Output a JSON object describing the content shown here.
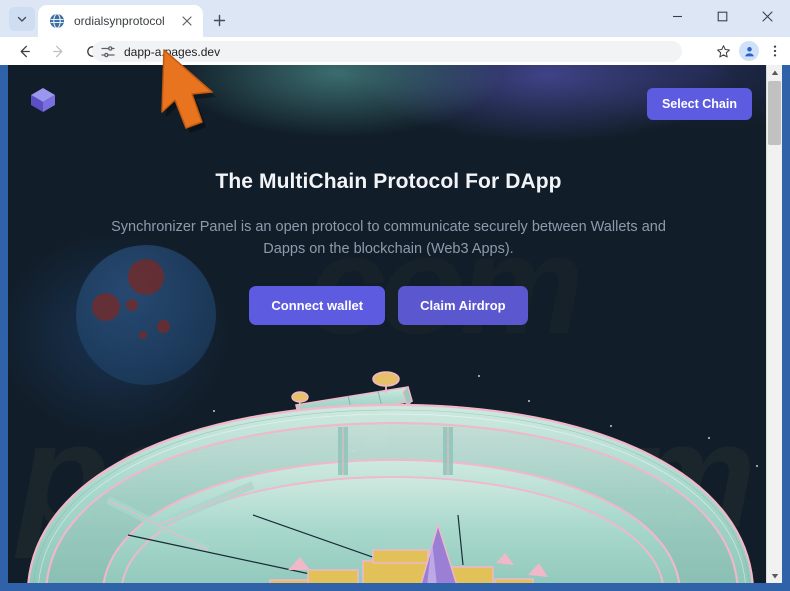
{
  "browser": {
    "tab": {
      "title": "ordialsynprotocol",
      "favicon_icon": "globe-icon",
      "close_icon": "close-icon"
    },
    "tab_search_icon": "chevron-down-icon",
    "new_tab_icon": "plus-icon",
    "window_controls": {
      "minimize_icon": "minimize-icon",
      "maximize_icon": "maximize-icon",
      "close_icon": "close-icon"
    },
    "toolbar": {
      "back_icon": "arrow-left-icon",
      "forward_icon": "arrow-right-icon",
      "reload_icon": "reload-icon",
      "site_settings_icon": "sliders-icon",
      "url": "dapp-a.pages.dev",
      "bookmark_icon": "star-icon",
      "profile_icon": "person-icon",
      "menu_icon": "three-dots-icon"
    },
    "scrollbar": {
      "up_icon": "triangle-up-icon",
      "down_icon": "triangle-down-icon"
    }
  },
  "page": {
    "header": {
      "logo_icon": "cube-logo-icon",
      "select_chain_label": "Select Chain"
    },
    "hero": {
      "title": "The MultiChain Protocol For DApp",
      "subtitle": "Synchronizer Panel is an open protocol to communicate securely between Wallets and Dapps on the blockchain (Web3 Apps).",
      "connect_wallet_label": "Connect wallet",
      "claim_airdrop_label": "Claim Airdrop"
    },
    "watermark": "pcrisk.com",
    "watermark_secondary": "com",
    "illustration_name": "space-station-illustration",
    "cursor_icon": "orange-arrow-cursor"
  },
  "colors": {
    "accent_purple": "#5d5ce0",
    "page_background": "#111d28",
    "browser_frame": "#2f62a8",
    "cursor_orange": "#e8741f"
  }
}
